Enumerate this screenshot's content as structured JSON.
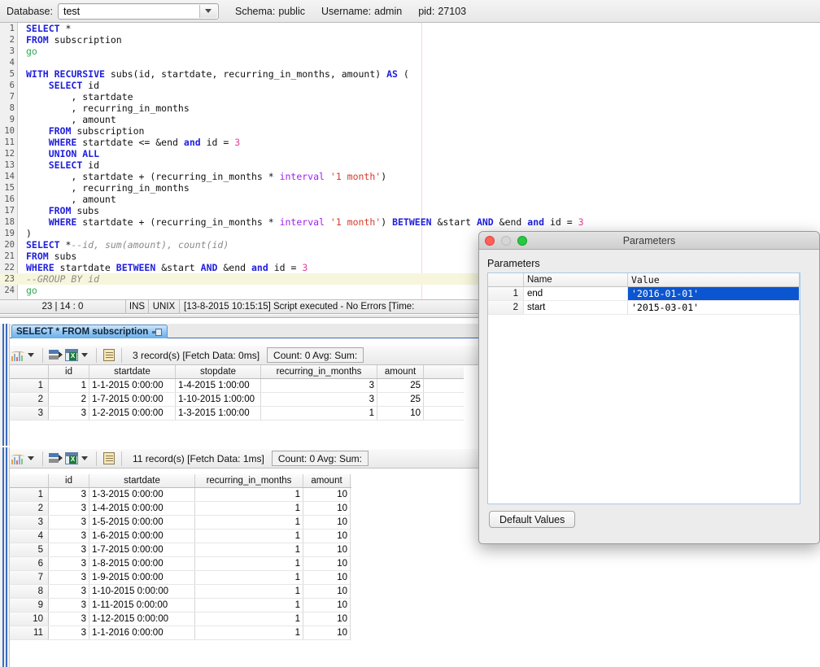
{
  "connection_bar": {
    "database_label": "Database:",
    "database_value": "test",
    "schema_label": "Schema:",
    "schema_value": "public",
    "username_label": "Username:",
    "username_value": "admin",
    "pid_label": "pid:",
    "pid_value": "27103"
  },
  "editor": {
    "highlight_line": 23,
    "lines": [
      {
        "n": "1",
        "parts": [
          {
            "t": "SELECT",
            "c": "kw"
          },
          {
            "t": " *",
            "c": "pln"
          }
        ]
      },
      {
        "n": "2",
        "parts": [
          {
            "t": "FROM",
            "c": "kw"
          },
          {
            "t": " subscription",
            "c": "pln"
          }
        ]
      },
      {
        "n": "3",
        "parts": [
          {
            "t": "go",
            "c": "grn"
          }
        ]
      },
      {
        "n": "4",
        "parts": []
      },
      {
        "n": "5",
        "parts": [
          {
            "t": "WITH RECURSIVE",
            "c": "kw"
          },
          {
            "t": " subs(id, startdate, recurring_in_months, amount) ",
            "c": "pln"
          },
          {
            "t": "AS",
            "c": "kw"
          },
          {
            "t": " (",
            "c": "pln"
          }
        ]
      },
      {
        "n": "6",
        "parts": [
          {
            "t": "    ",
            "c": "pln"
          },
          {
            "t": "SELECT",
            "c": "kw"
          },
          {
            "t": " id",
            "c": "pln"
          }
        ]
      },
      {
        "n": "7",
        "parts": [
          {
            "t": "        , startdate",
            "c": "pln"
          }
        ]
      },
      {
        "n": "8",
        "parts": [
          {
            "t": "        , recurring_in_months",
            "c": "pln"
          }
        ]
      },
      {
        "n": "9",
        "parts": [
          {
            "t": "        , amount",
            "c": "pln"
          }
        ]
      },
      {
        "n": "10",
        "parts": [
          {
            "t": "    ",
            "c": "pln"
          },
          {
            "t": "FROM",
            "c": "kw"
          },
          {
            "t": " subscription",
            "c": "pln"
          }
        ]
      },
      {
        "n": "11",
        "parts": [
          {
            "t": "    ",
            "c": "pln"
          },
          {
            "t": "WHERE",
            "c": "kw"
          },
          {
            "t": " startdate <= &end ",
            "c": "pln"
          },
          {
            "t": "and",
            "c": "kw"
          },
          {
            "t": " id = ",
            "c": "pln"
          },
          {
            "t": "3",
            "c": "num"
          }
        ]
      },
      {
        "n": "12",
        "parts": [
          {
            "t": "    ",
            "c": "pln"
          },
          {
            "t": "UNION ALL",
            "c": "kw"
          }
        ]
      },
      {
        "n": "13",
        "parts": [
          {
            "t": "    ",
            "c": "pln"
          },
          {
            "t": "SELECT",
            "c": "kw"
          },
          {
            "t": " id",
            "c": "pln"
          }
        ]
      },
      {
        "n": "14",
        "parts": [
          {
            "t": "        , startdate + (recurring_in_months * ",
            "c": "pln"
          },
          {
            "t": "interval",
            "c": "pur"
          },
          {
            "t": " ",
            "c": "pln"
          },
          {
            "t": "'1 month'",
            "c": "str"
          },
          {
            "t": ")",
            "c": "pln"
          }
        ]
      },
      {
        "n": "15",
        "parts": [
          {
            "t": "        , recurring_in_months",
            "c": "pln"
          }
        ]
      },
      {
        "n": "16",
        "parts": [
          {
            "t": "        , amount",
            "c": "pln"
          }
        ]
      },
      {
        "n": "17",
        "parts": [
          {
            "t": "    ",
            "c": "pln"
          },
          {
            "t": "FROM",
            "c": "kw"
          },
          {
            "t": " subs",
            "c": "pln"
          }
        ]
      },
      {
        "n": "18",
        "parts": [
          {
            "t": "    ",
            "c": "pln"
          },
          {
            "t": "WHERE",
            "c": "kw"
          },
          {
            "t": " startdate + (recurring_in_months * ",
            "c": "pln"
          },
          {
            "t": "interval",
            "c": "pur"
          },
          {
            "t": " ",
            "c": "pln"
          },
          {
            "t": "'1 month'",
            "c": "str"
          },
          {
            "t": ") ",
            "c": "pln"
          },
          {
            "t": "BETWEEN",
            "c": "kw"
          },
          {
            "t": " &start ",
            "c": "pln"
          },
          {
            "t": "AND",
            "c": "kw"
          },
          {
            "t": " &end ",
            "c": "pln"
          },
          {
            "t": "and",
            "c": "kw"
          },
          {
            "t": " id = ",
            "c": "pln"
          },
          {
            "t": "3",
            "c": "num"
          }
        ]
      },
      {
        "n": "19",
        "parts": [
          {
            "t": ")",
            "c": "pln"
          }
        ]
      },
      {
        "n": "20",
        "parts": [
          {
            "t": "SELECT",
            "c": "kw"
          },
          {
            "t": " *",
            "c": "pln"
          },
          {
            "t": "--id, sum(amount), count(id)",
            "c": "cmt"
          }
        ]
      },
      {
        "n": "21",
        "parts": [
          {
            "t": "FROM",
            "c": "kw"
          },
          {
            "t": " subs",
            "c": "pln"
          }
        ]
      },
      {
        "n": "22",
        "parts": [
          {
            "t": "WHERE",
            "c": "kw"
          },
          {
            "t": " startdate ",
            "c": "pln"
          },
          {
            "t": "BETWEEN",
            "c": "kw"
          },
          {
            "t": " &start ",
            "c": "pln"
          },
          {
            "t": "AND",
            "c": "kw"
          },
          {
            "t": " &end ",
            "c": "pln"
          },
          {
            "t": "and",
            "c": "kw"
          },
          {
            "t": " id = ",
            "c": "pln"
          },
          {
            "t": "3",
            "c": "num"
          }
        ]
      },
      {
        "n": "23",
        "parts": [
          {
            "t": "--GROUP BY id",
            "c": "cmt"
          }
        ]
      },
      {
        "n": "24",
        "parts": [
          {
            "t": "go",
            "c": "grn"
          }
        ]
      }
    ]
  },
  "editor_status": {
    "position": "23 | 14 : 0",
    "insert_mode": "INS",
    "line_ending": "UNIX",
    "message": "[13-8-2015 10:15:15] Script executed - No Errors [Time:"
  },
  "result_tab": {
    "label": "SELECT * FROM subscription"
  },
  "panel1": {
    "toolbar": {
      "records": "3 record(s) [Fetch Data: 0ms]",
      "aggregates": "Count: 0  Avg:   Sum:"
    },
    "columns": [
      "id",
      "startdate",
      "stopdate",
      "recurring_in_months",
      "amount"
    ],
    "rows": [
      {
        "n": "1",
        "cells": [
          "1",
          "1-1-2015 0:00:00",
          "1-4-2015 1:00:00",
          "3",
          "25"
        ]
      },
      {
        "n": "2",
        "cells": [
          "2",
          "1-7-2015 0:00:00",
          "1-10-2015 1:00:00",
          "3",
          "25"
        ]
      },
      {
        "n": "3",
        "cells": [
          "3",
          "1-2-2015 0:00:00",
          "1-3-2015 1:00:00",
          "1",
          "10"
        ]
      }
    ]
  },
  "panel2": {
    "toolbar": {
      "records": "11 record(s) [Fetch Data: 1ms]",
      "aggregates": "Count: 0  Avg:   Sum:"
    },
    "columns": [
      "id",
      "startdate",
      "recurring_in_months",
      "amount"
    ],
    "rows": [
      {
        "n": "1",
        "cells": [
          "3",
          "1-3-2015 0:00:00",
          "1",
          "10"
        ]
      },
      {
        "n": "2",
        "cells": [
          "3",
          "1-4-2015 0:00:00",
          "1",
          "10"
        ]
      },
      {
        "n": "3",
        "cells": [
          "3",
          "1-5-2015 0:00:00",
          "1",
          "10"
        ]
      },
      {
        "n": "4",
        "cells": [
          "3",
          "1-6-2015 0:00:00",
          "1",
          "10"
        ]
      },
      {
        "n": "5",
        "cells": [
          "3",
          "1-7-2015 0:00:00",
          "1",
          "10"
        ]
      },
      {
        "n": "6",
        "cells": [
          "3",
          "1-8-2015 0:00:00",
          "1",
          "10"
        ]
      },
      {
        "n": "7",
        "cells": [
          "3",
          "1-9-2015 0:00:00",
          "1",
          "10"
        ]
      },
      {
        "n": "8",
        "cells": [
          "3",
          "1-10-2015 0:00:00",
          "1",
          "10"
        ]
      },
      {
        "n": "9",
        "cells": [
          "3",
          "1-11-2015 0:00:00",
          "1",
          "10"
        ]
      },
      {
        "n": "10",
        "cells": [
          "3",
          "1-12-2015 0:00:00",
          "1",
          "10"
        ]
      },
      {
        "n": "11",
        "cells": [
          "3",
          "1-1-2016 0:00:00",
          "1",
          "10"
        ]
      }
    ]
  },
  "dialog": {
    "title": "Parameters",
    "section_label": "Parameters",
    "columns": [
      "",
      "Name",
      "Value"
    ],
    "rows": [
      {
        "n": "1",
        "name": "end",
        "value": "'2016-01-01'",
        "selected": true
      },
      {
        "n": "2",
        "name": "start",
        "value": "'2015-03-01'",
        "selected": false
      }
    ],
    "default_values_button": "Default Values"
  },
  "colors": {
    "accent_blue": "#0b56d0",
    "tab_blue": "#8fc4f2",
    "rail_blue": "#3b6bc4",
    "keyword": "#2020dd",
    "string": "#d33b2a",
    "comment": "#8a8a8a",
    "number": "#e0409a"
  }
}
